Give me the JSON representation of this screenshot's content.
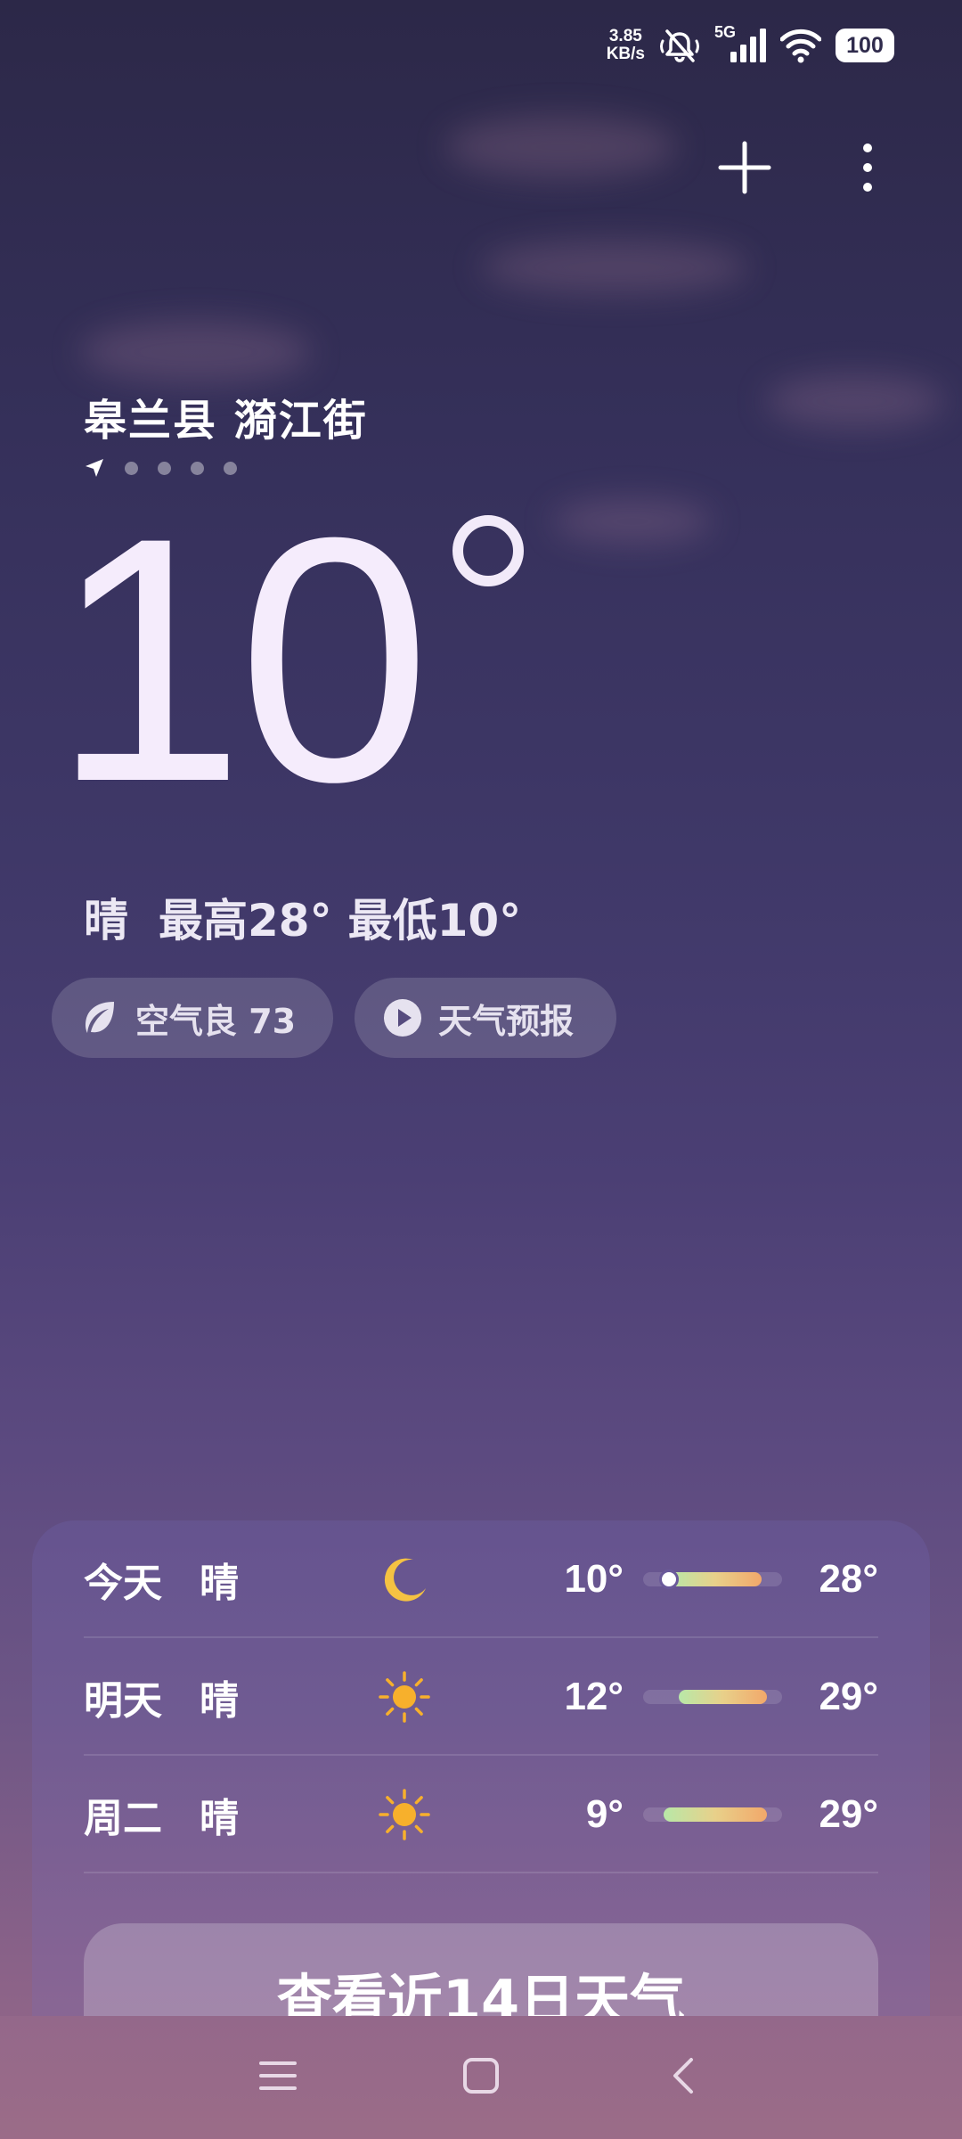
{
  "status_bar": {
    "net_speed_value": "3.85",
    "net_speed_unit": "KB/s",
    "network_type": "5G",
    "battery": "100",
    "icons": [
      "mute-icon",
      "signal-icon",
      "wifi-icon",
      "battery-icon"
    ]
  },
  "top_actions": {
    "add": "plus-icon",
    "menu": "more-vertical-icon"
  },
  "location": {
    "name": "皋兰县 漪江街",
    "pages": 5,
    "current_page_icon": "location-arrow-icon"
  },
  "current": {
    "temperature": "10",
    "condition": "晴",
    "high": "最高28°",
    "low": "最低10°"
  },
  "pills": {
    "air_quality": "空气良 73",
    "forecast_video": "天气预报"
  },
  "forecast": [
    {
      "day": "今天",
      "condition": "晴",
      "icon": "moon-icon",
      "low": "10°",
      "high": "28°",
      "low_value": 10,
      "high_value": 28,
      "current_marker": 10
    },
    {
      "day": "明天",
      "condition": "晴",
      "icon": "sun-icon",
      "low": "12°",
      "high": "29°",
      "low_value": 12,
      "high_value": 29
    },
    {
      "day": "周二",
      "condition": "晴",
      "icon": "sun-icon",
      "low": "9°",
      "high": "29°",
      "low_value": 9,
      "high_value": 29
    }
  ],
  "view_14_days": "查看近14日天气",
  "colors": {
    "temp_bar_start": "#b8e8a8",
    "temp_bar_end": "#f2a86a",
    "sun": "#f7b02c",
    "moon": "#f5c242"
  },
  "nav": [
    "menu-icon",
    "home-icon",
    "back-icon"
  ]
}
